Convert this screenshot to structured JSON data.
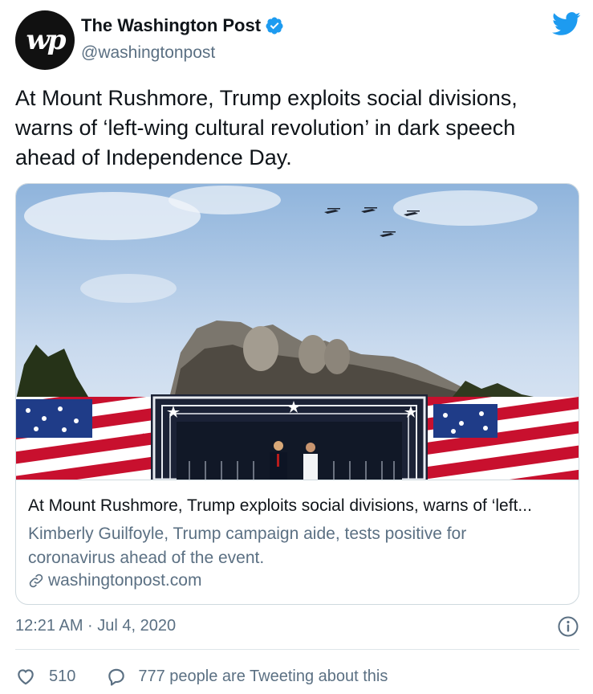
{
  "account": {
    "avatar_text": "wp",
    "display_name": "The Washington Post",
    "handle": "@washingtonpost",
    "verified": true
  },
  "tweet": {
    "text": "At Mount Rushmore, Trump exploits social divisions, warns of ‘left-wing cultural revolution’ in dark speech ahead of Independence Day."
  },
  "card": {
    "title": "At Mount Rushmore, Trump exploits social divisions, warns of ‘left...",
    "description": "Kimberly Guilfoyle, Trump campaign aide, tests positive for coronavirus ahead of the event.",
    "domain": "washingtonpost.com"
  },
  "meta": {
    "timestamp": "12:21 AM · Jul 4, 2020"
  },
  "actions": {
    "like_count": "510",
    "reply_text": "777 people are Tweeting about this"
  },
  "colors": {
    "twitter_blue": "#1d9bf0",
    "secondary_text": "#5b7083",
    "border": "#cfd9de"
  }
}
